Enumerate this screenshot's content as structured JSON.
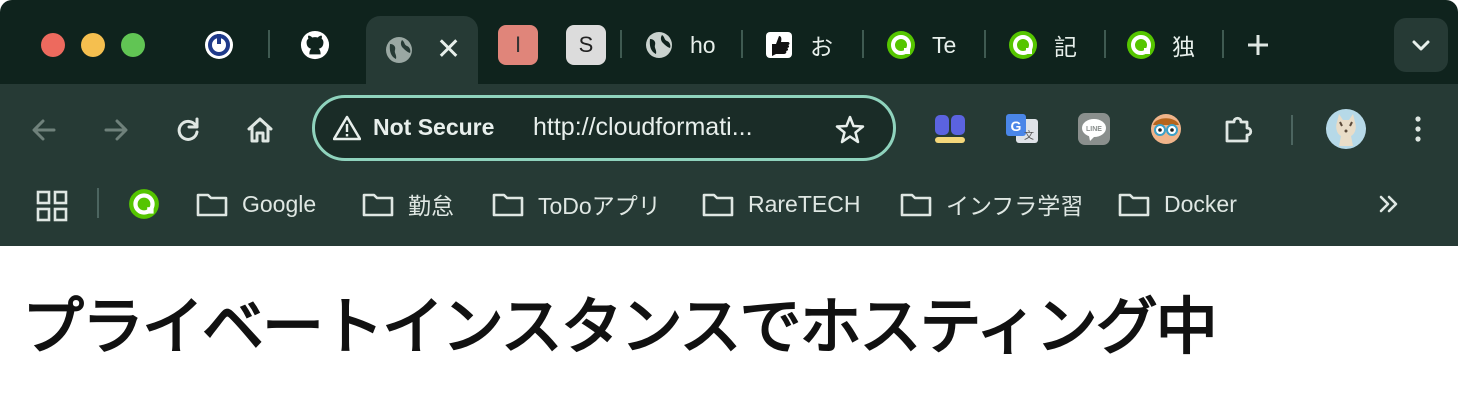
{
  "tabs": [
    {
      "icon": "clock-app-icon",
      "title": ""
    },
    {
      "icon": "github-icon",
      "title": ""
    },
    {
      "icon": "globe-icon",
      "title": "",
      "active": true
    },
    {
      "icon": "letter-i-icon",
      "title": "I"
    },
    {
      "icon": "letter-s-icon",
      "title": "S"
    },
    {
      "icon": "globe-icon",
      "title": "ho"
    },
    {
      "icon": "thumbs-up-icon",
      "title": "お"
    },
    {
      "icon": "qiita-icon",
      "title": "Te"
    },
    {
      "icon": "qiita-icon",
      "title": "記"
    },
    {
      "icon": "qiita-icon",
      "title": "独"
    }
  ],
  "toolbar": {
    "security_label": "Not Secure",
    "url": "http://cloudformati..."
  },
  "bookmarks": [
    {
      "label": "Google"
    },
    {
      "label": "勤怠"
    },
    {
      "label": "ToDoアプリ"
    },
    {
      "label": "RareTECH"
    },
    {
      "label": "インフラ学習"
    },
    {
      "label": "Docker"
    }
  ],
  "content": {
    "heading": "プライベートインスタンスでホスティング中"
  },
  "colors": {
    "titlebar": "#0f231d",
    "toolbar": "#263a35",
    "omnibox_border": "#8fd3bd",
    "qiita_green": "#55c500"
  }
}
